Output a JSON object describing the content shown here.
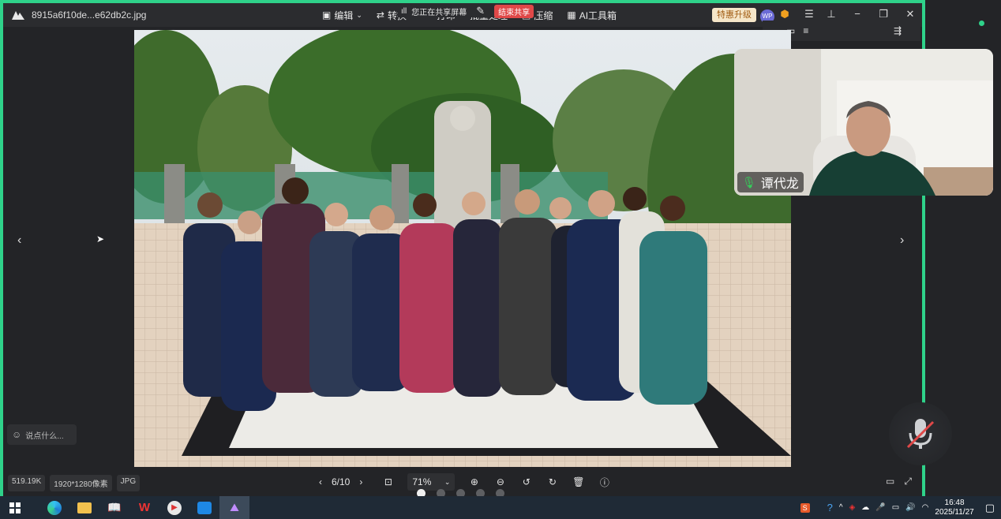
{
  "titlebar": {
    "file_name": "8915a6f10de...e62db2c.jpg",
    "tools": [
      "编辑",
      "转换",
      "打印",
      "批量处理",
      "压缩",
      "AI工具箱"
    ],
    "share_status": "您正在共享屏幕",
    "end_share": "结束共享",
    "promo": "特惠升级",
    "avatar_text": "WP"
  },
  "video": {
    "speaker_name": "谭代龙"
  },
  "chat": {
    "placeholder": "说点什么..."
  },
  "meta": {
    "file_size": "519.19K",
    "dimensions": "1920*1280像素",
    "format": "JPG"
  },
  "viewer": {
    "page": "6/10",
    "zoom": "71%",
    "dots_total": 5,
    "dots_active": 1
  },
  "taskbar": {
    "time": "16:48",
    "date": "2025/11/27"
  },
  "colors": {
    "share_border": "#2fd28a",
    "end_share": "#e04848",
    "promo_bg": "#f5e6c8"
  }
}
